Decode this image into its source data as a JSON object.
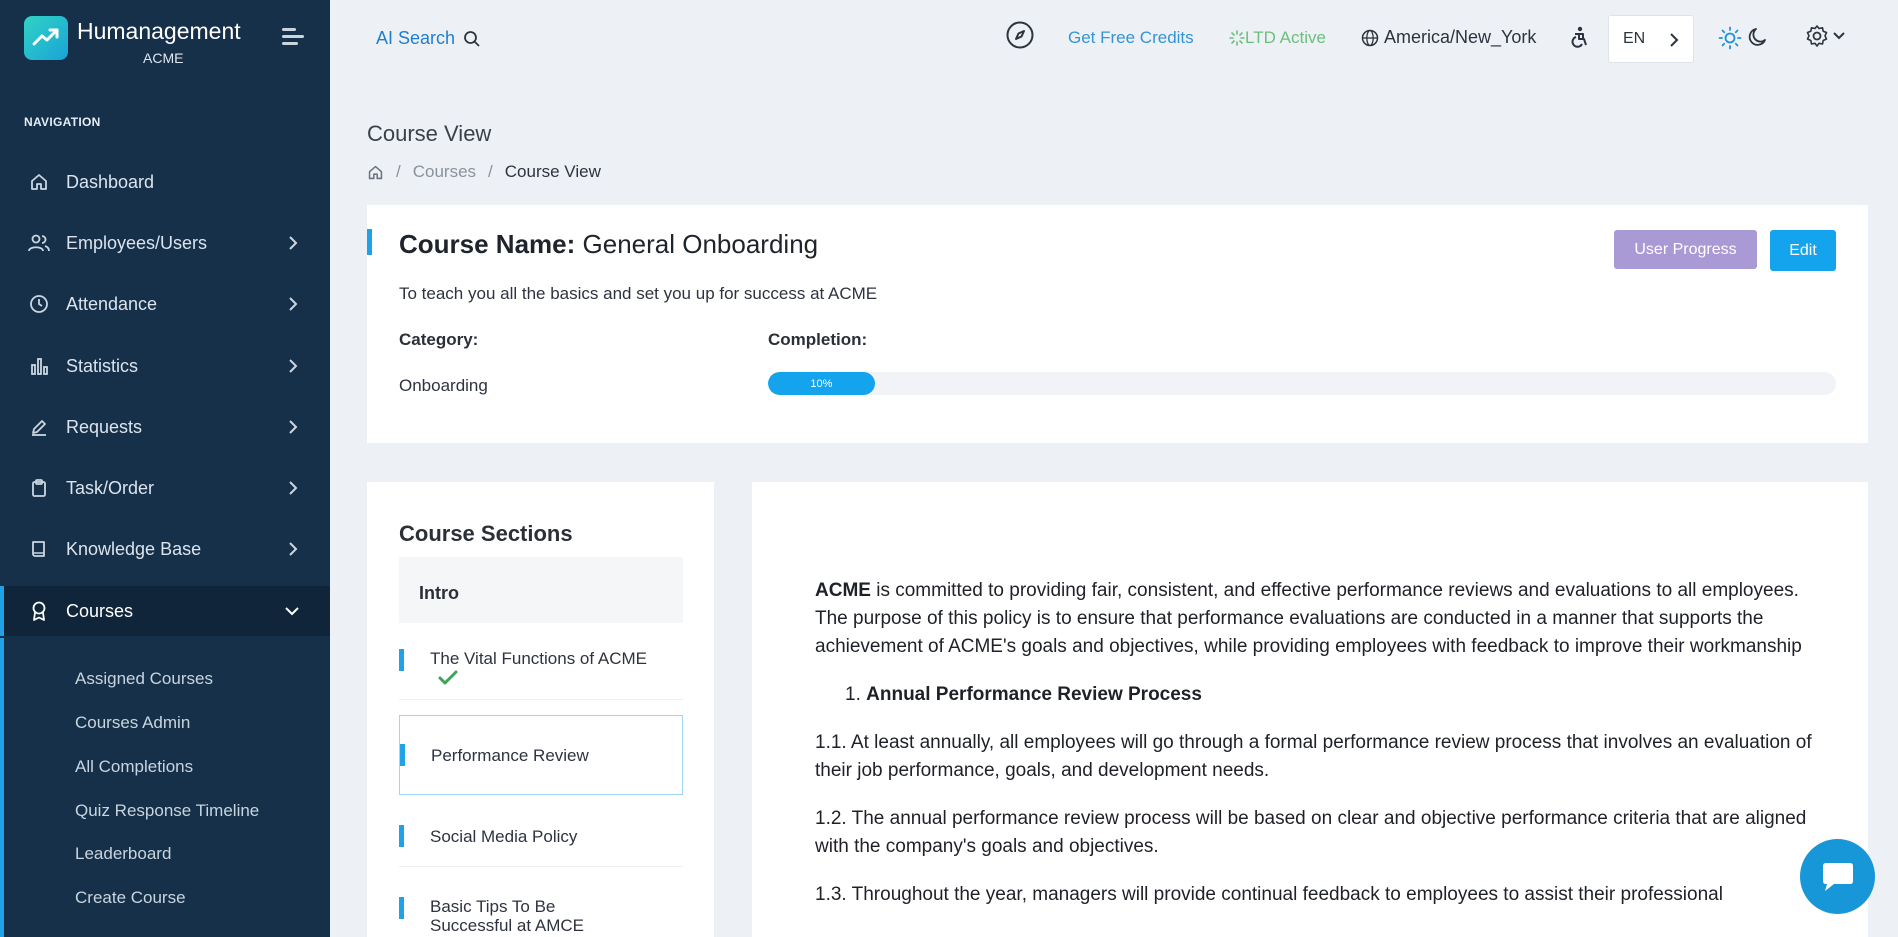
{
  "app": {
    "name": "Humanagement",
    "org": "ACME"
  },
  "sidebar": {
    "heading": "NAVIGATION",
    "items": [
      {
        "label": "Dashboard",
        "icon": "home-icon"
      },
      {
        "label": "Employees/Users",
        "icon": "users-icon"
      },
      {
        "label": "Attendance",
        "icon": "clock-icon"
      },
      {
        "label": "Statistics",
        "icon": "bar-chart-icon"
      },
      {
        "label": "Requests",
        "icon": "pencil-icon"
      },
      {
        "label": "Task/Order",
        "icon": "clipboard-icon"
      },
      {
        "label": "Knowledge Base",
        "icon": "book-icon"
      },
      {
        "label": "Courses",
        "icon": "award-icon",
        "active": true
      }
    ],
    "sub_items": [
      "Assigned Courses",
      "Courses Admin",
      "All Completions",
      "Quiz Response Timeline",
      "Leaderboard",
      "Create Course"
    ]
  },
  "header": {
    "ai_search": "AI Search",
    "credits": "Get Free Credits",
    "ltd": "LTD Active",
    "timezone": "America/New_York",
    "language": "EN"
  },
  "page": {
    "title": "Course View",
    "breadcrumb": [
      "Courses",
      "Course View"
    ]
  },
  "course": {
    "name_label": "Course Name:",
    "name": "General Onboarding",
    "description": "To teach you all the basics and set you up for success at ACME",
    "category_label": "Category:",
    "category": "Onboarding",
    "completion_label": "Completion:",
    "completion_text": "10%",
    "completion_fraction": 0.1,
    "buttons": {
      "user_progress": "User Progress",
      "edit": "Edit"
    }
  },
  "sections": {
    "title": "Course Sections",
    "items": [
      {
        "label": "Intro"
      },
      {
        "label": "The Vital Functions of ACME",
        "completed": true
      },
      {
        "label": "Performance Review",
        "selected": true
      },
      {
        "label": "Social Media Policy"
      },
      {
        "label": "Basic Tips To Be Successful at AMCE"
      }
    ]
  },
  "content": {
    "intro_bold": "ACME",
    "intro_text": " is committed to providing fair, consistent, and effective performance reviews and evaluations to all employees. The purpose of this policy is to ensure that performance evaluations are conducted in a manner that supports the achievement of ACME's goals and objectives, while providing employees with feedback to improve their workmanship",
    "heading_num": "1.",
    "heading": "Annual Performance Review Process",
    "p1": "1.1. At least annually, all employees will go through a formal performance review process that involves an evaluation of their job performance, goals, and development needs.",
    "p2": "1.2. The annual performance review process will be based on clear and objective performance criteria that are aligned with the company's goals and objectives.",
    "p3": "1.3. Throughout the year, managers will provide continual feedback to employees to assist their professional"
  },
  "colors": {
    "sidebar_bg": "#163049",
    "accent": "#14a4ee",
    "user_progress_button": "#a99ad6",
    "ltd_green": "#6bc07d"
  }
}
